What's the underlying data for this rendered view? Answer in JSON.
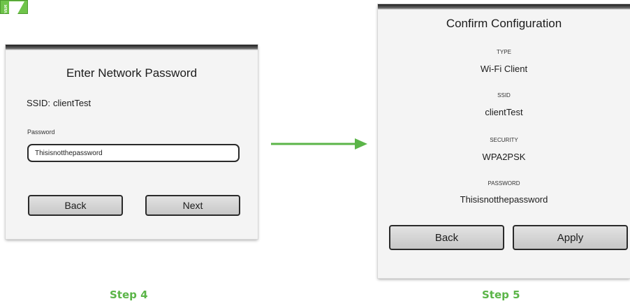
{
  "badge": {
    "vertical_text": "VER"
  },
  "step4": {
    "title": "Enter Network Password",
    "ssid_label": "SSID:",
    "ssid_value": "clientTest",
    "password_label": "Password",
    "password_value": "Thisisnotthepassword",
    "back_label": "Back",
    "next_label": "Next",
    "caption": "Step 4"
  },
  "step5": {
    "title": "Confirm Configuration",
    "fields": [
      {
        "label": "TYPE",
        "value": "Wi-Fi Client"
      },
      {
        "label": "SSID",
        "value": "clientTest"
      },
      {
        "label": "SECURITY",
        "value": "WPA2PSK"
      },
      {
        "label": "PASSWORD",
        "value": "Thisisnotthepassword"
      }
    ],
    "back_label": "Back",
    "apply_label": "Apply",
    "caption": "Step 5"
  },
  "colors": {
    "accent_green": "#5bb548",
    "badge_green": "#6fc44a",
    "button_gray": "#d4d4d4",
    "screen_bg": "#f4f4f4"
  },
  "icons": {
    "arrow": "right-arrow-icon"
  }
}
